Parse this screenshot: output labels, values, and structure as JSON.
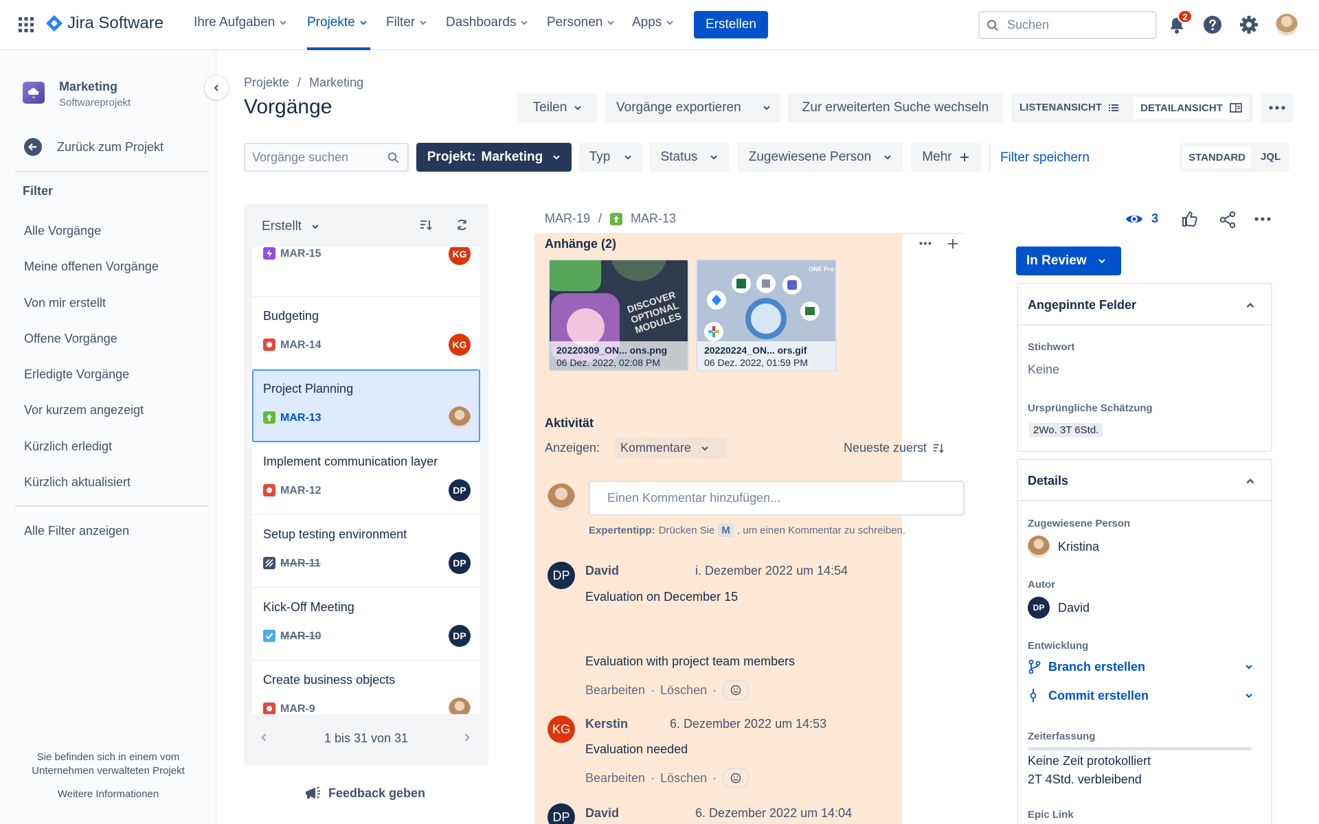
{
  "topbar": {
    "product": "Jira Software",
    "nav": [
      "Ihre Aufgaben",
      "Projekte",
      "Filter",
      "Dashboards",
      "Personen",
      "Apps"
    ],
    "create": "Erstellen",
    "search_placeholder": "Suchen",
    "notification_count": "2"
  },
  "sidebar": {
    "project_name": "Marketing",
    "project_type": "Softwareprojekt",
    "back": "Zurück zum Projekt",
    "filter_heading": "Filter",
    "filters": [
      "Alle Vorgänge",
      "Meine offenen Vorgänge",
      "Von mir erstellt",
      "Offene Vorgänge",
      "Erledigte Vorgänge",
      "Vor kurzem angezeigt",
      "Kürzlich erledigt",
      "Kürzlich aktualisiert"
    ],
    "all_filters": "Alle Filter anzeigen",
    "footer_note": "Sie befinden sich in einem vom Unternehmen verwalteten Projekt",
    "more_info": "Weitere Informationen"
  },
  "header": {
    "breadcrumb": [
      "Projekte",
      "Marketing"
    ],
    "title": "Vorgänge",
    "share": "Teilen",
    "export": "Vorgänge exportieren",
    "advanced": "Zur erweiterten Suche wechseln",
    "list_view": "LISTENANSICHT",
    "detail_view": "DETAILANSICHT"
  },
  "filterbar": {
    "search_placeholder": "Vorgänge suchen",
    "project_label": "Projekt:",
    "project_value": "Marketing",
    "type": "Typ",
    "status": "Status",
    "assignee": "Zugewiesene Person",
    "more": "Mehr",
    "save": "Filter speichern",
    "standard": "STANDARD",
    "jql": "JQL"
  },
  "list": {
    "sort": "Erstellt",
    "pagination": "1 bis 31 von 31",
    "feedback": "Feedback geben",
    "issues": [
      {
        "title": "",
        "key": "MAR-15",
        "assignee": "KG"
      },
      {
        "title": "Budgeting",
        "key": "MAR-14",
        "assignee": "KG"
      },
      {
        "title": "Project Planning",
        "key": "MAR-13",
        "assignee": ""
      },
      {
        "title": "Implement communication layer",
        "key": "MAR-12",
        "assignee": "DP"
      },
      {
        "title": "Setup testing environment",
        "key": "MAR-11",
        "assignee": "DP"
      },
      {
        "title": "Kick-Off Meeting",
        "key": "MAR-10",
        "assignee": "DP"
      },
      {
        "title": "Create business objects",
        "key": "MAR-9",
        "assignee": ""
      }
    ]
  },
  "detail": {
    "parent_key": "MAR-19",
    "key": "MAR-13",
    "watchers": "3",
    "attachments_title": "Anhänge (2)",
    "attachments": [
      {
        "name": "20220309_ON... ons.png",
        "date": "06 Dez. 2022, 02:08 PM",
        "thumb_text": "DISCOVER OPTIONAL MODULES"
      },
      {
        "name": "20220224_ON... ors.gif",
        "date": "06 Dez. 2022, 01:59 PM",
        "thumb_text": "ONE Pro"
      }
    ],
    "activity_title": "Aktivität",
    "show_label": "Anzeigen:",
    "show_value": "Kommentare",
    "order": "Neueste zuerst",
    "comment_placeholder": "Einen Kommentar hinzufügen...",
    "tip_bold": "Expertentipp:",
    "tip_pre": "Drücken Sie",
    "tip_key": "M",
    "tip_post": ", um einen Kommentar zu schreiben.",
    "comments": [
      {
        "author": "David",
        "initials": "DP",
        "date": "6. Dezember 2022 um 14:54",
        "date_shown": "i. Dezember 2022 um 14:54",
        "lines": [
          "Evaluation on December 15",
          "Evaluation with project team members"
        ]
      },
      {
        "author": "Kerstin",
        "initials": "KG",
        "date": "6. Dezember 2022 um 14:53",
        "lines": [
          "Evaluation needed"
        ]
      },
      {
        "author": "David",
        "initials": "DP",
        "date": "6. Dezember 2022 um 14:04",
        "lines": []
      }
    ],
    "edit": "Bearbeiten",
    "delete": "Löschen",
    "status": "In Review"
  },
  "pinned": {
    "title": "Angepinnte Felder",
    "keyword_label": "Stichwort",
    "keyword_value": "Keine",
    "estimate_label": "Ursprüngliche Schätzung",
    "estimate_value": "2Wo. 3T 6Std."
  },
  "details": {
    "title": "Details",
    "assignee_label": "Zugewiesene Person",
    "assignee": "Kristina",
    "author_label": "Autor",
    "author": "David",
    "author_initials": "DP",
    "dev_label": "Entwicklung",
    "branch": "Branch erstellen",
    "commit": "Commit erstellen",
    "time_label": "Zeiterfassung",
    "time_logged": "Keine Zeit protokolliert",
    "time_remaining": "2T 4Std. verbleibend",
    "epic_label": "Epic Link"
  },
  "colors": {
    "brand": "#0052cc",
    "kg": "#de350b",
    "dp": "#172b4d",
    "highlight": "#ffe9d6"
  }
}
